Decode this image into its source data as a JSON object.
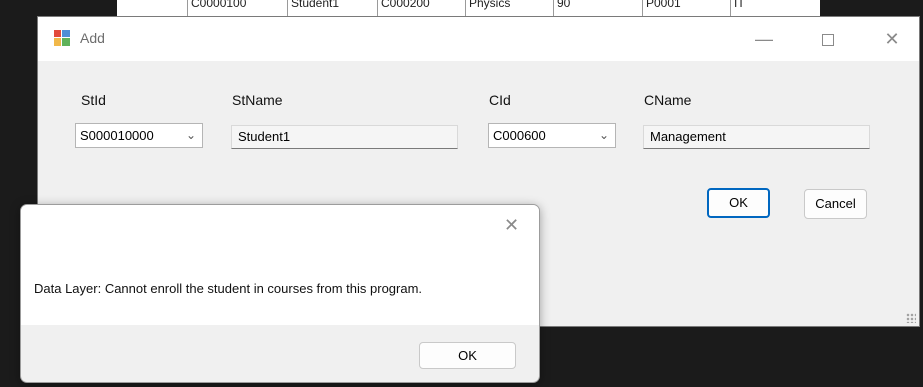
{
  "background_table": {
    "cells": [
      "C0000100",
      "Student1",
      "C000200",
      "Physics",
      "90",
      "P0001",
      "IT"
    ]
  },
  "add_dialog": {
    "title": "Add",
    "labels": {
      "stid": "StId",
      "stname": "StName",
      "cid": "CId",
      "cname": "CName"
    },
    "values": {
      "stid": "S000010000",
      "stname": "Student1",
      "cid": "C000600",
      "cname": "Management"
    },
    "ok_label": "OK",
    "cancel_label": "Cancel",
    "controls": {
      "minimize": "—",
      "close": "✕"
    }
  },
  "message_box": {
    "text": "Data Layer: Cannot enroll the student in courses from this program.",
    "ok_label": "OK",
    "close_glyph": "✕"
  },
  "colors": {
    "accent": "#0067c0",
    "window_bg": "#f0f0f0",
    "desktop": "#1b1b1b"
  }
}
